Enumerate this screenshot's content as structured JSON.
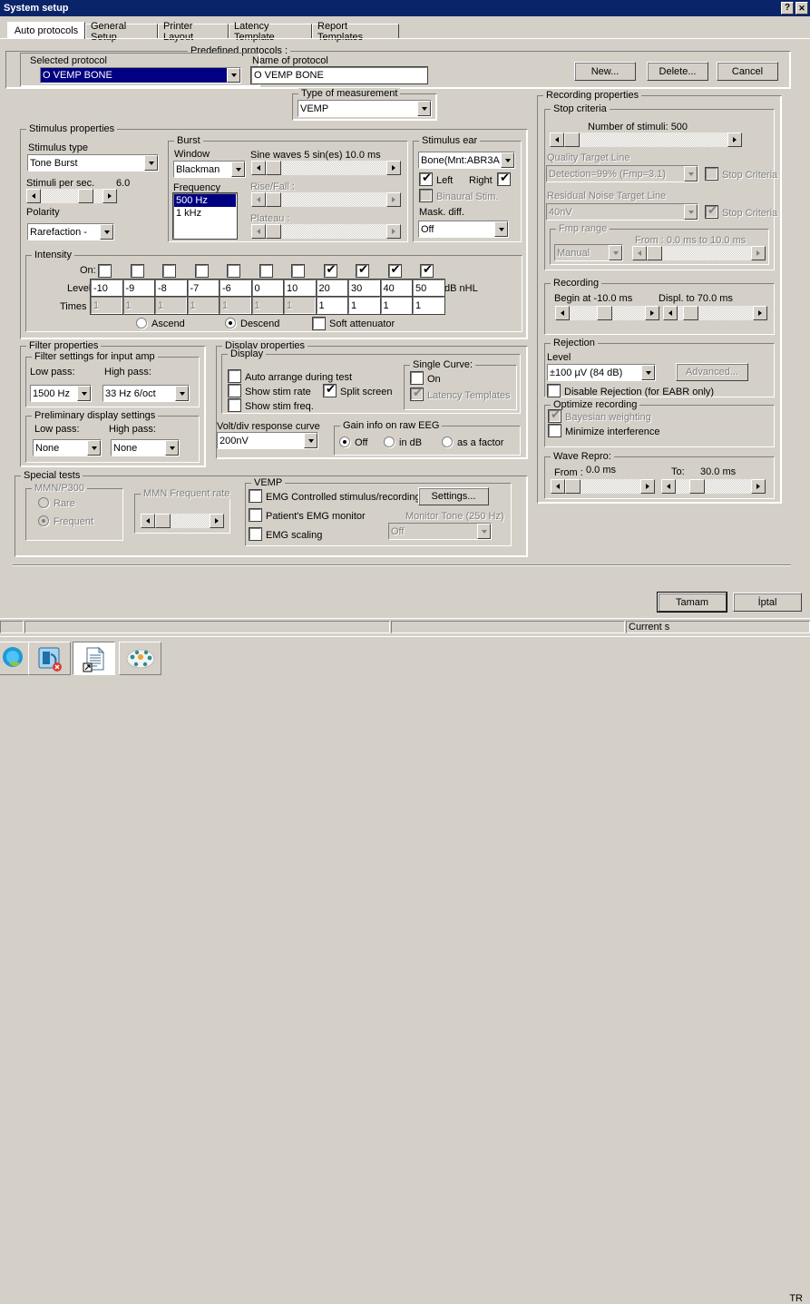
{
  "window": {
    "title": "System setup",
    "help_button": "?",
    "close_button": "✕"
  },
  "tabs": [
    {
      "label": "Auto protocols",
      "selected": true
    },
    {
      "label": "General Setup",
      "selected": false
    },
    {
      "label": "Printer Layout",
      "selected": false
    },
    {
      "label": "Latency Template",
      "selected": false
    },
    {
      "label": "Report Templates",
      "selected": false
    }
  ],
  "predefined_protocols": {
    "caption": "Predefined protocols :",
    "selected_protocol_label": "Selected protocol",
    "selected_protocol_value": "O VEMP BONE",
    "name_of_protocol_label": "Name of protocol",
    "name_of_protocol_value": "O VEMP BONE",
    "buttons": {
      "new": "New...",
      "delete": "Delete...",
      "cancel": "Cancel"
    }
  },
  "type_of_measurement": {
    "caption": "Type of measurement",
    "value": "VEMP"
  },
  "stimulus_properties": {
    "caption": "Stimulus properties",
    "stimulus_type_label": "Stimulus type",
    "stimulus_type_value": "Tone Burst",
    "stimuli_per_sec_label": "Stimuli per sec.",
    "stimuli_per_sec_value": "6.0",
    "polarity_label": "Polarity",
    "polarity_value": "Rarefaction -",
    "burst": {
      "caption": "Burst",
      "window_label": "Window",
      "window_value": "Blackman",
      "frequency_label": "Frequency",
      "frequency_options": [
        "500 Hz",
        "1 kHz"
      ],
      "frequency_selected": "500 Hz",
      "sine_waves_label": "Sine waves 5 sin(es) 10.0 ms",
      "rise_fall_label": "Rise/Fall :",
      "plateau_label": "Plateau :"
    },
    "stimulus_ear": {
      "caption": "Stimulus ear",
      "transducer_value": "Bone(Mnt:ABR3A",
      "left_label": "Left",
      "left_checked": true,
      "right_label": "Right",
      "right_checked": true,
      "binaural_label": "Binaural Stim.",
      "binaural_checked": false,
      "mask_diff_label": "Mask. diff.",
      "mask_diff_value": "Off"
    }
  },
  "intensity": {
    "caption": "Intensity",
    "on_label": "On:",
    "level_label": "Level",
    "times_label": "Times :",
    "unit_label": "dB nHL",
    "columns": [
      {
        "on": false,
        "level": "-10",
        "times": "1",
        "times_enabled": false
      },
      {
        "on": false,
        "level": "-9",
        "times": "1",
        "times_enabled": false
      },
      {
        "on": false,
        "level": "-8",
        "times": "1",
        "times_enabled": false
      },
      {
        "on": false,
        "level": "-7",
        "times": "1",
        "times_enabled": false
      },
      {
        "on": false,
        "level": "-6",
        "times": "1",
        "times_enabled": false
      },
      {
        "on": false,
        "level": "0",
        "times": "1",
        "times_enabled": false
      },
      {
        "on": false,
        "level": "10",
        "times": "1",
        "times_enabled": false
      },
      {
        "on": true,
        "level": "20",
        "times": "1",
        "times_enabled": true
      },
      {
        "on": true,
        "level": "30",
        "times": "1",
        "times_enabled": true
      },
      {
        "on": true,
        "level": "40",
        "times": "1",
        "times_enabled": true
      },
      {
        "on": true,
        "level": "50",
        "times": "1",
        "times_enabled": true
      }
    ],
    "ascend_label": "Ascend",
    "descend_label": "Descend",
    "order_selected": "Descend",
    "soft_attenuator_label": "Soft attenuator",
    "soft_attenuator_checked": false
  },
  "filter_properties": {
    "caption": "Filter properties",
    "input_amp": {
      "caption": "Filter settings for input amp",
      "low_pass_label": "Low pass:",
      "low_pass_value": "1500 Hz",
      "high_pass_label": "High pass:",
      "high_pass_value": "33 Hz 6/oct"
    },
    "preliminary": {
      "caption": "Preliminary display settings",
      "low_pass_label": "Low pass:",
      "low_pass_value": "None",
      "high_pass_label": "High pass:",
      "high_pass_value": "None"
    }
  },
  "display_properties": {
    "caption": "Display properties",
    "display": {
      "caption": "Display",
      "auto_arrange_label": "Auto arrange during test",
      "auto_arrange_checked": false,
      "show_stim_rate_label": "Show stim rate",
      "show_stim_rate_checked": false,
      "show_stim_freq_label": "Show stim freq.",
      "show_stim_freq_checked": false,
      "split_screen_label": "Split screen",
      "split_screen_checked": true,
      "single_curve": {
        "caption": "Single Curve:",
        "on_label": "On",
        "on_checked": false,
        "latency_templates_label": "Latency Templates",
        "latency_templates_checked": true
      }
    },
    "volt_div_label": "Volt/div response curve",
    "volt_div_value": "200nV",
    "gain_info": {
      "caption": "Gain info on raw EEG",
      "options": [
        "Off",
        "in dB",
        "as a factor"
      ],
      "selected": "Off"
    }
  },
  "special_tests": {
    "caption": "Special tests",
    "mmn_p300": {
      "caption": "MMN/P300",
      "rare_label": "Rare",
      "frequent_label": "Frequent",
      "selected": "Frequent"
    },
    "mmn_frequent_rate": {
      "caption": "MMN Frequent rate"
    },
    "vemp": {
      "caption": "VEMP",
      "emg_controlled_label": "EMG Controlled stimulus/recording",
      "emg_controlled_checked": false,
      "patient_emg_monitor_label": "Patient's EMG monitor",
      "patient_emg_monitor_checked": false,
      "emg_scaling_label": "EMG scaling",
      "emg_scaling_checked": false,
      "settings_button": "Settings...",
      "monitor_tone_label": "Monitor Tone (250 Hz)",
      "monitor_tone_value": "Off"
    }
  },
  "recording_properties": {
    "caption": "Recording properties",
    "stop_criteria": {
      "caption": "Stop criteria",
      "number_of_stimuli_label": "Number of stimuli:  500",
      "quality_target_line_label": "Quality Target Line",
      "quality_target_line_value": "Detection=99% (Fmp=3.1)",
      "quality_stop_criteria_label": "Stop Criteria",
      "quality_stop_criteria_checked": false,
      "residual_noise_label": "Residual Noise Target Line",
      "residual_noise_value": "40nV",
      "residual_stop_criteria_label": "Stop Criteria",
      "residual_stop_criteria_checked": true,
      "fmp_range": {
        "caption": "Fmp range",
        "mode_value": "Manual",
        "range_label": "From : 0.0 ms to 10.0 ms"
      }
    },
    "recording": {
      "caption": "Recording",
      "begin_at_label": "Begin at  -10.0 ms",
      "displ_to_label": "Displ. to  70.0 ms"
    },
    "rejection": {
      "caption": "Rejection",
      "level_label": "Level",
      "level_value": "±100 µV (84 dB)",
      "advanced_button": "Advanced...",
      "disable_rejection_label": "Disable Rejection (for EABR only)",
      "disable_rejection_checked": false
    },
    "optimize_recording": {
      "caption": "Optimize recording",
      "bayesian_label": "Bayesian weighting",
      "bayesian_checked": true,
      "minimize_interference_label": "Minimize interference",
      "minimize_interference_checked": false
    },
    "wave_repro": {
      "caption": "Wave Repro:",
      "from_label": "From :",
      "from_value": "0.0 ms",
      "to_label": "To:",
      "to_value": "30.0 ms"
    }
  },
  "dialog_buttons": {
    "ok": "Tamam",
    "cancel": "İptal"
  },
  "status_bar": {
    "panel1": "",
    "panel2": "",
    "panel3": "",
    "panel4": "Current s"
  },
  "taskbar": {
    "items": [
      {
        "name": "skype-icon",
        "active": false
      },
      {
        "name": "outlook-icon",
        "active": false
      },
      {
        "name": "document-shortcut-icon",
        "active": true
      },
      {
        "name": "network-nodes-icon",
        "active": false
      }
    ],
    "tray_language": "TR"
  },
  "colors": {
    "titlebar": "#0a246a",
    "face": "#d4d0c8",
    "highlight": "#000080",
    "disabled_text": "#808080"
  }
}
